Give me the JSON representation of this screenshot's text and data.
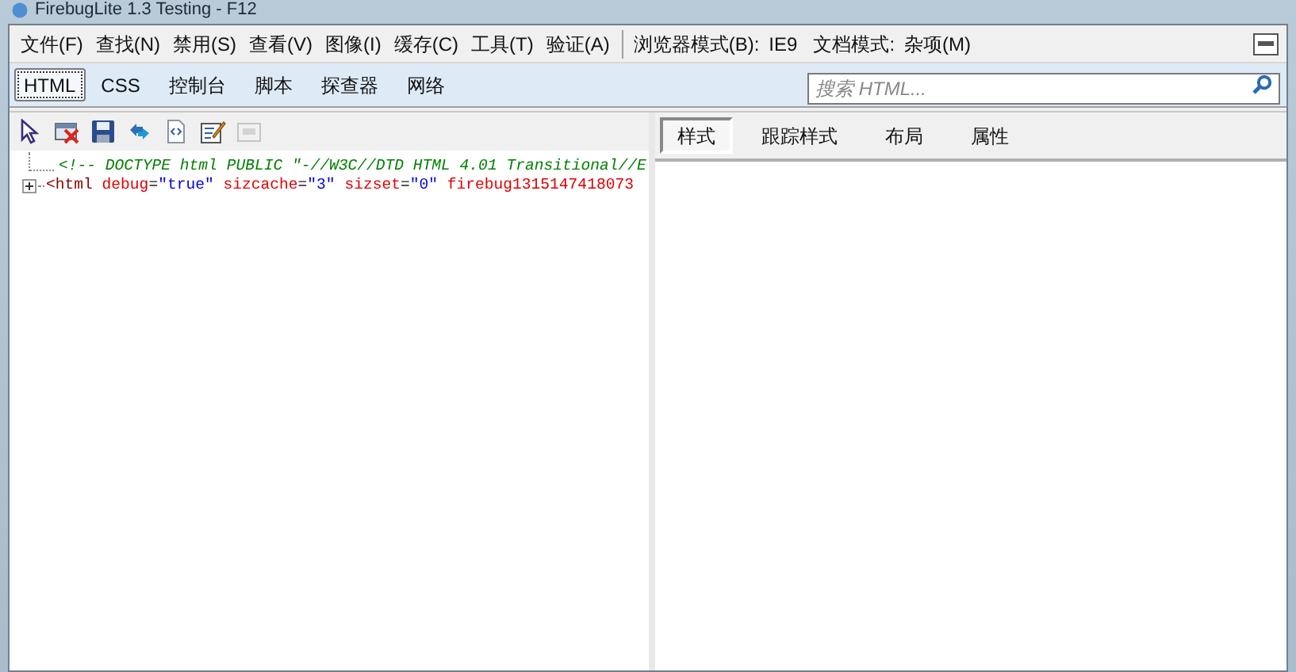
{
  "window": {
    "title": "FirebugLite 1.3 Testing - F12"
  },
  "menu": [
    {
      "label": "文件(F)"
    },
    {
      "label": "查找(N)"
    },
    {
      "label": "禁用(S)"
    },
    {
      "label": "查看(V)"
    },
    {
      "label": "图像(I)"
    },
    {
      "label": "缓存(C)"
    },
    {
      "label": "工具(T)"
    },
    {
      "label": "验证(A)"
    }
  ],
  "modes": [
    {
      "label": "浏览器模式(B):",
      "value": "IE9"
    },
    {
      "label": "文档模式:",
      "value": "杂项(M)"
    }
  ],
  "tabs": [
    {
      "label": "HTML",
      "selected": true
    },
    {
      "label": "CSS",
      "selected": false
    },
    {
      "label": "控制台",
      "selected": false
    },
    {
      "label": "脚本",
      "selected": false
    },
    {
      "label": "探查器",
      "selected": false
    },
    {
      "label": "网络",
      "selected": false
    }
  ],
  "search": {
    "placeholder": "搜索 HTML..."
  },
  "toolbar": [
    {
      "kind": "pointer",
      "disabled": false
    },
    {
      "kind": "clear",
      "disabled": false
    },
    {
      "kind": "save",
      "disabled": false
    },
    {
      "kind": "refresh",
      "disabled": false
    },
    {
      "kind": "source",
      "disabled": false
    },
    {
      "kind": "edit",
      "disabled": false
    },
    {
      "kind": "panel",
      "disabled": true
    }
  ],
  "tree": [
    {
      "kind": "comment",
      "text": "<!-- DOCTYPE html PUBLIC \"-//W3C//DTD HTML 4.01 Transitional//E"
    },
    {
      "kind": "element",
      "expanded": false,
      "tokens": [
        {
          "kind": "tag",
          "text": "<html"
        },
        {
          "kind": "name",
          "text": " debug"
        },
        {
          "kind": "punct",
          "text": "="
        },
        {
          "kind": "value",
          "text": "\"true\""
        },
        {
          "kind": "name",
          "text": " sizcache"
        },
        {
          "kind": "punct",
          "text": "="
        },
        {
          "kind": "value",
          "text": "\"3\""
        },
        {
          "kind": "name",
          "text": " sizset"
        },
        {
          "kind": "punct",
          "text": "="
        },
        {
          "kind": "value",
          "text": "\"0\""
        },
        {
          "kind": "name",
          "text": " firebug1315147418073"
        }
      ]
    }
  ],
  "side_tabs": [
    {
      "label": "样式",
      "selected": true
    },
    {
      "label": "跟踪样式",
      "selected": false
    },
    {
      "label": "布局",
      "selected": false
    },
    {
      "label": "属性",
      "selected": false
    }
  ]
}
